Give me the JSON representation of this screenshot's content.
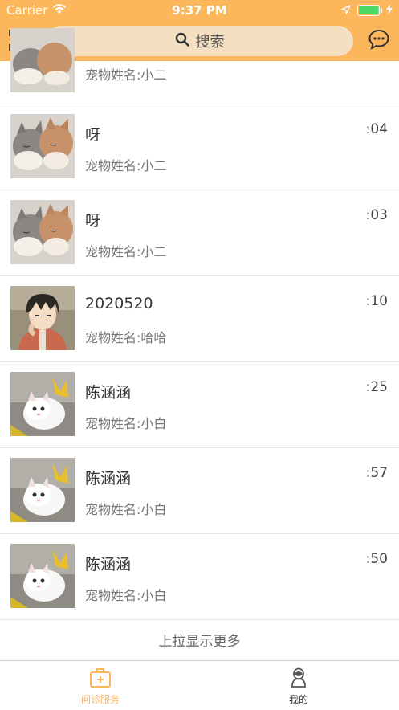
{
  "status_bar": {
    "carrier": "Carrier",
    "time": "9:37 PM"
  },
  "header": {
    "search_label": "搜索",
    "background_color": "#fcb65b",
    "search_background": "#f5dfc1"
  },
  "list": {
    "items": [
      {
        "title": "",
        "time": "",
        "pet": "宠物姓名:小二",
        "image": "cats"
      },
      {
        "title": "呀",
        "time": ":04",
        "pet": "宠物姓名:小二",
        "image": "cats"
      },
      {
        "title": "呀",
        "time": ":03",
        "pet": "宠物姓名:小二",
        "image": "cats"
      },
      {
        "title": "2020520",
        "time": ":10",
        "pet": "宠物姓名:哈哈",
        "image": "anime-boy"
      },
      {
        "title": "陈涵涵",
        "time": ":25",
        "pet": "宠物姓名:小白",
        "image": "white-kitten"
      },
      {
        "title": "陈涵涵",
        "time": ":57",
        "pet": "宠物姓名:小白",
        "image": "white-kitten"
      },
      {
        "title": "陈涵涵",
        "time": ":50",
        "pet": "宠物姓名:小白",
        "image": "white-kitten"
      }
    ],
    "load_more": "上拉显示更多"
  },
  "tabbar": {
    "tabs": [
      {
        "label": "问诊服务",
        "icon": "medical-kit-icon",
        "active": true
      },
      {
        "label": "我的",
        "icon": "profile-icon",
        "active": false
      }
    ],
    "active_color": "#fcb65b"
  }
}
